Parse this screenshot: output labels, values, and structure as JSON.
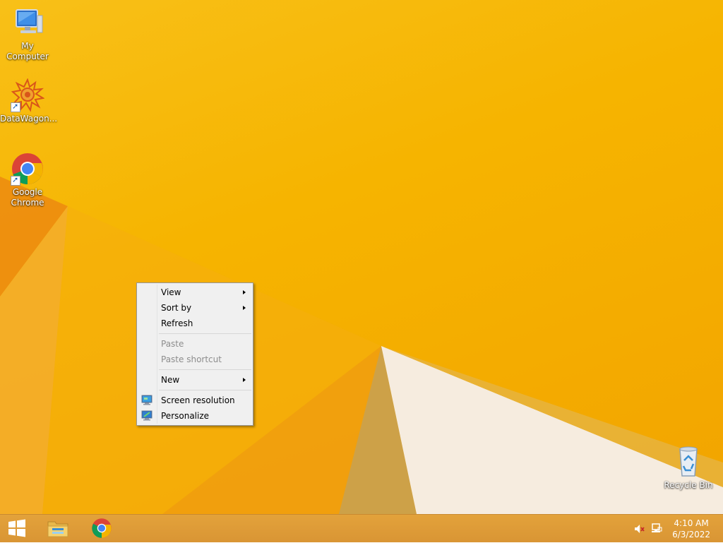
{
  "desktop": {
    "icons": [
      {
        "label": "My Computer",
        "icon": "computer-icon"
      },
      {
        "label": "DataWagon...",
        "icon": "datawagon-icon"
      },
      {
        "label": "Google Chrome",
        "icon": "chrome-icon"
      },
      {
        "label": "Recycle Bin",
        "icon": "recycle-bin-icon"
      }
    ]
  },
  "context_menu": {
    "items": [
      {
        "label": "View",
        "submenu": true,
        "enabled": true
      },
      {
        "label": "Sort by",
        "submenu": true,
        "enabled": true
      },
      {
        "label": "Refresh",
        "submenu": false,
        "enabled": true
      },
      {
        "label": "Paste",
        "submenu": false,
        "enabled": false
      },
      {
        "label": "Paste shortcut",
        "submenu": false,
        "enabled": false
      },
      {
        "label": "New",
        "submenu": true,
        "enabled": true
      },
      {
        "label": "Screen resolution",
        "submenu": false,
        "enabled": true,
        "icon": "screen-resolution-icon"
      },
      {
        "label": "Personalize",
        "submenu": false,
        "enabled": true,
        "icon": "personalize-icon"
      }
    ]
  },
  "taskbar": {
    "buttons": [
      {
        "name": "start",
        "icon": "windows-logo-icon"
      },
      {
        "name": "file-explorer",
        "icon": "folder-icon"
      },
      {
        "name": "chrome",
        "icon": "chrome-icon"
      }
    ],
    "tray": {
      "volume_icon": "volume-muted-icon",
      "network_icon": "network-icon"
    },
    "clock": {
      "time": "4:10 AM",
      "date": "6/3/2022"
    }
  },
  "colors": {
    "wallpaper": "#f6b400",
    "taskbar": "#dd9a37",
    "menu_bg": "#f0f0f0"
  }
}
